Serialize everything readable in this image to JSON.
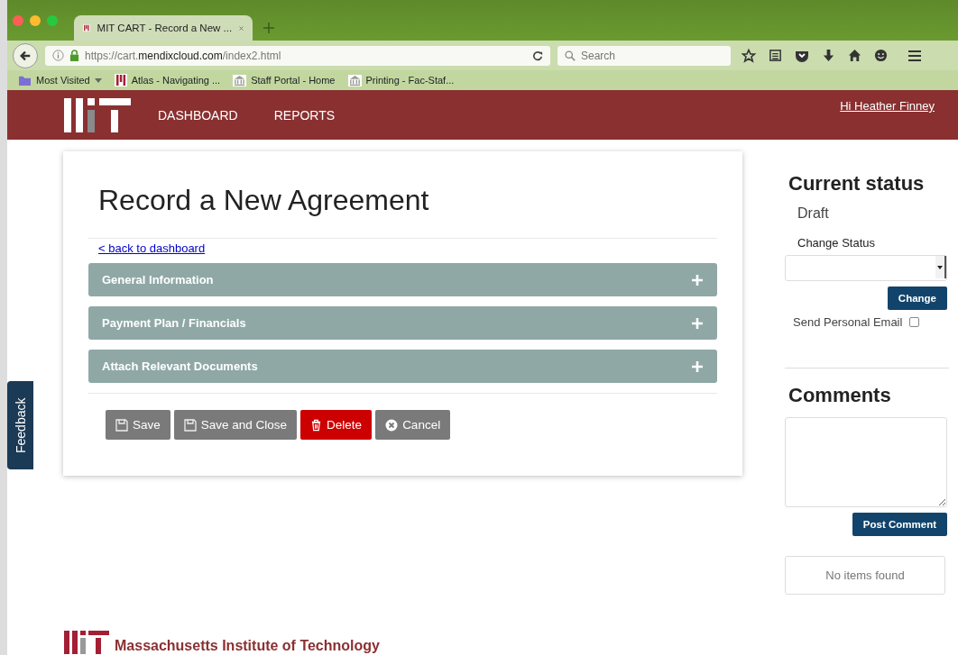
{
  "browser": {
    "tab_title": "MIT CART - Record a New ...",
    "url_host": "https://cart.",
    "url_domain": "mendixcloud.com",
    "url_path": "/index2.html",
    "search_placeholder": "Search",
    "bookmarks": [
      {
        "label": "Most Visited",
        "kind": "folder"
      },
      {
        "label": "Atlas - Navigating ...",
        "kind": "mit"
      },
      {
        "label": "Staff Portal - Home",
        "kind": "building"
      },
      {
        "label": "Printing - Fac-Staf...",
        "kind": "building"
      }
    ]
  },
  "header": {
    "nav": [
      {
        "label": "DASHBOARD"
      },
      {
        "label": "REPORTS"
      }
    ],
    "user_link": "Hi Heather Finney"
  },
  "main": {
    "title": "Record a New Agreement",
    "back_link": "< back to dashboard",
    "sections": [
      {
        "label": "General Information",
        "expanded": false
      },
      {
        "label": "Payment Plan / Financials",
        "expanded": false
      },
      {
        "label": "Attach Relevant Documents",
        "expanded": false
      }
    ],
    "buttons": [
      {
        "label": "Save",
        "kind": "save"
      },
      {
        "label": "Save and Close",
        "kind": "save"
      },
      {
        "label": "Delete",
        "kind": "delete"
      },
      {
        "label": "Cancel",
        "kind": "cancel"
      }
    ]
  },
  "feedback": "Feedback",
  "status": {
    "heading": "Current status",
    "value": "Draft",
    "change_label": "Change Status",
    "change_button": "Change",
    "email_label": "Send Personal Email",
    "email_checked": false
  },
  "comments": {
    "heading": "Comments",
    "post_button": "Post Comment",
    "empty": "No items found"
  },
  "footer": {
    "name": "Massachusetts Institute of Technology"
  }
}
